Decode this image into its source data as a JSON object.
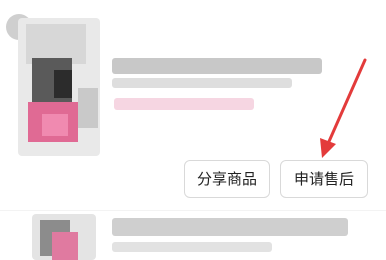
{
  "order_item": {
    "share_button_label": "分享商品",
    "after_sale_button_label": "申请售后"
  },
  "annotation_color": "#e33b3b"
}
